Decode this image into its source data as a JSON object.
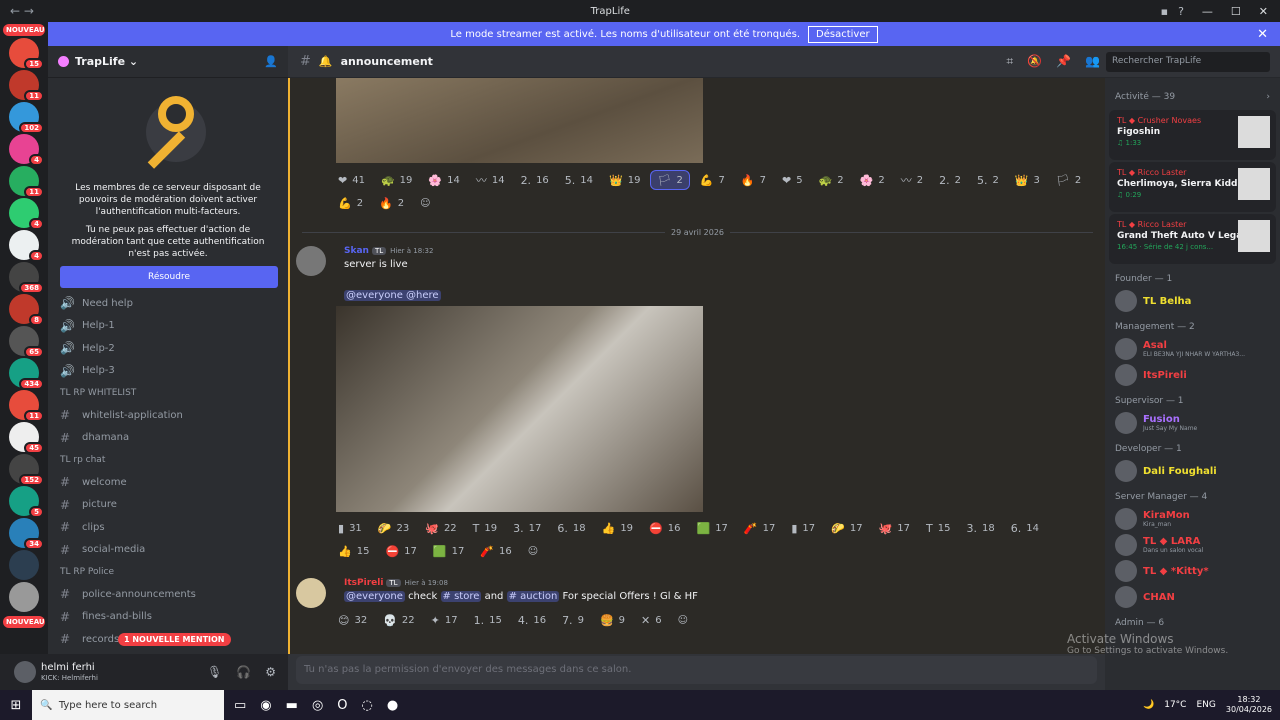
{
  "window": {
    "title": "TrapLife"
  },
  "banner": {
    "text": "Le mode streamer est activé. Les noms d'utilisateur ont été tronqués.",
    "button": "Désactiver"
  },
  "servers": {
    "new_label": "NOUVEAU",
    "badges": [
      "15",
      "11",
      "102",
      "4",
      "11",
      "4",
      "4",
      "368",
      "8",
      "65",
      "434",
      "11",
      "45",
      "152",
      "5",
      "34"
    ]
  },
  "server": {
    "name": "TrapLife"
  },
  "mod_notice": {
    "line1": "Les membres de ce serveur disposant de pouvoirs de modération doivent activer l'authentification multi-facteurs.",
    "line2": "Tu ne peux pas effectuer d'action de modération tant que cette authentification n'est pas activée.",
    "button": "Résoudre"
  },
  "channels": [
    {
      "name": "Need help",
      "type": "voice"
    },
    {
      "name": "Help-1",
      "type": "voice"
    },
    {
      "name": "Help-2",
      "type": "voice"
    },
    {
      "name": "Help-3",
      "type": "voice"
    },
    {
      "category": "TL RP WHITELIST"
    },
    {
      "name": "whitelist-application",
      "type": "text"
    },
    {
      "name": "dhamana",
      "type": "text"
    },
    {
      "category": "TL rp chat"
    },
    {
      "name": "welcome",
      "type": "text"
    },
    {
      "name": "picture",
      "type": "text"
    },
    {
      "name": "clips",
      "type": "text"
    },
    {
      "name": "social-media",
      "type": "text"
    },
    {
      "category": "TL RP Police"
    },
    {
      "name": "police-announcements",
      "type": "text"
    },
    {
      "name": "fines-and-bills",
      "type": "text"
    },
    {
      "name": "records-examples",
      "type": "text"
    }
  ],
  "new_mention": "1 NOUVELLE MENTION",
  "user": {
    "name": "helmi ferhi",
    "status": "KICK: Helmiferhi"
  },
  "chat": {
    "channel": "announcement",
    "search": "Rechercher TrapLife",
    "date_divider": "29 avril 2026",
    "composer": "Tu n'as pas la permission d'envoyer des messages dans ce salon."
  },
  "reactions1": [
    "41",
    "19",
    "14",
    "14",
    "16",
    "14",
    "19",
    "2",
    "7",
    "7",
    "5",
    "2",
    "2",
    "2",
    "2",
    "2",
    "3",
    "2",
    "2",
    "2"
  ],
  "msg1": {
    "user": "Skan",
    "tag": "TL",
    "time": "Hier à 18:32",
    "text": "server is live",
    "mentions": "@everyone  @here"
  },
  "reactions2": [
    "31",
    "23",
    "22",
    "19",
    "17",
    "18",
    "19",
    "16",
    "17",
    "17",
    "17",
    "17",
    "17",
    "15",
    "18",
    "14",
    "15",
    "17",
    "17",
    "16"
  ],
  "msg2": {
    "user": "ItsPireli",
    "tag": "TL",
    "time": "Hier à 19:08",
    "everyone": "@everyone",
    "check": "check",
    "store": "store",
    "and": "and",
    "auction": "auction",
    "rest": "For special Offers ! Gl & HF"
  },
  "reactions3": [
    "32",
    "22",
    "17",
    "15",
    "16",
    "9",
    "9",
    "6"
  ],
  "members": {
    "activity": "Activité — 39",
    "cards": [
      {
        "user": "TL ◆ Crusher Novaes",
        "game": "Figoshin",
        "extra": "♫ 1:33"
      },
      {
        "user": "TL ◆ Ricco Laster",
        "game": "Cherlimoya, Sierra Kidd",
        "extra": "♫ 0:29"
      },
      {
        "user": "TL ◆ Ricco Laster",
        "game": "Grand Theft Auto V Legacy",
        "extra": "16:45 · Série de 42 j cons..."
      }
    ],
    "groups": [
      {
        "title": "Founder — 1",
        "members": [
          {
            "name": "TL Belha",
            "sub": "",
            "color": "#f0e030"
          }
        ]
      },
      {
        "title": "Management — 2",
        "members": [
          {
            "name": "Asal",
            "sub": "ELI BE3NA YJI NHAR W YARTHA3...",
            "color": "#f23f43"
          },
          {
            "name": "ItsPireli",
            "sub": "",
            "color": "#f23f43"
          }
        ]
      },
      {
        "title": "Supervisor — 1",
        "members": [
          {
            "name": "Fusion",
            "sub": "Just Say My Name",
            "color": "#a970ff"
          }
        ]
      },
      {
        "title": "Developer — 1",
        "members": [
          {
            "name": "Dali Foughali",
            "sub": "",
            "color": "#f0e030"
          }
        ]
      },
      {
        "title": "Server Manager — 4",
        "members": [
          {
            "name": "KiraMon",
            "sub": "Kira_man",
            "color": "#f23f43"
          },
          {
            "name": "TL ◆ LARA",
            "sub": "Dans un salon vocal",
            "color": "#f23f43"
          },
          {
            "name": "TL ◆ *Kitty*",
            "sub": "",
            "color": "#f23f43"
          },
          {
            "name": "CHAN",
            "sub": "",
            "color": "#f23f43"
          }
        ]
      },
      {
        "title": "Admin — 6",
        "members": []
      }
    ]
  },
  "watermark": {
    "title": "Activate Windows",
    "sub": "Go to Settings to activate Windows."
  },
  "taskbar": {
    "search": "Type here to search",
    "temp": "17°C",
    "lang": "ENG",
    "time": "18:32",
    "date": "30/04/2026"
  }
}
